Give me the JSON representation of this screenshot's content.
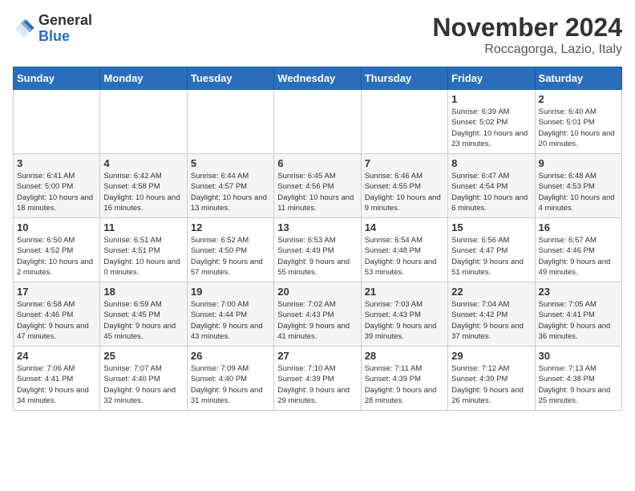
{
  "logo": {
    "general": "General",
    "blue": "Blue"
  },
  "title": "November 2024",
  "subtitle": "Roccagorga, Lazio, Italy",
  "days_header": [
    "Sunday",
    "Monday",
    "Tuesday",
    "Wednesday",
    "Thursday",
    "Friday",
    "Saturday"
  ],
  "weeks": [
    [
      {
        "day": "",
        "info": ""
      },
      {
        "day": "",
        "info": ""
      },
      {
        "day": "",
        "info": ""
      },
      {
        "day": "",
        "info": ""
      },
      {
        "day": "",
        "info": ""
      },
      {
        "day": "1",
        "info": "Sunrise: 6:39 AM\nSunset: 5:02 PM\nDaylight: 10 hours and 23 minutes."
      },
      {
        "day": "2",
        "info": "Sunrise: 6:40 AM\nSunset: 5:01 PM\nDaylight: 10 hours and 20 minutes."
      }
    ],
    [
      {
        "day": "3",
        "info": "Sunrise: 6:41 AM\nSunset: 5:00 PM\nDaylight: 10 hours and 18 minutes."
      },
      {
        "day": "4",
        "info": "Sunrise: 6:42 AM\nSunset: 4:58 PM\nDaylight: 10 hours and 16 minutes."
      },
      {
        "day": "5",
        "info": "Sunrise: 6:44 AM\nSunset: 4:57 PM\nDaylight: 10 hours and 13 minutes."
      },
      {
        "day": "6",
        "info": "Sunrise: 6:45 AM\nSunset: 4:56 PM\nDaylight: 10 hours and 11 minutes."
      },
      {
        "day": "7",
        "info": "Sunrise: 6:46 AM\nSunset: 4:55 PM\nDaylight: 10 hours and 9 minutes."
      },
      {
        "day": "8",
        "info": "Sunrise: 6:47 AM\nSunset: 4:54 PM\nDaylight: 10 hours and 6 minutes."
      },
      {
        "day": "9",
        "info": "Sunrise: 6:48 AM\nSunset: 4:53 PM\nDaylight: 10 hours and 4 minutes."
      }
    ],
    [
      {
        "day": "10",
        "info": "Sunrise: 6:50 AM\nSunset: 4:52 PM\nDaylight: 10 hours and 2 minutes."
      },
      {
        "day": "11",
        "info": "Sunrise: 6:51 AM\nSunset: 4:51 PM\nDaylight: 10 hours and 0 minutes."
      },
      {
        "day": "12",
        "info": "Sunrise: 6:52 AM\nSunset: 4:50 PM\nDaylight: 9 hours and 57 minutes."
      },
      {
        "day": "13",
        "info": "Sunrise: 6:53 AM\nSunset: 4:49 PM\nDaylight: 9 hours and 55 minutes."
      },
      {
        "day": "14",
        "info": "Sunrise: 6:54 AM\nSunset: 4:48 PM\nDaylight: 9 hours and 53 minutes."
      },
      {
        "day": "15",
        "info": "Sunrise: 6:56 AM\nSunset: 4:47 PM\nDaylight: 9 hours and 51 minutes."
      },
      {
        "day": "16",
        "info": "Sunrise: 6:57 AM\nSunset: 4:46 PM\nDaylight: 9 hours and 49 minutes."
      }
    ],
    [
      {
        "day": "17",
        "info": "Sunrise: 6:58 AM\nSunset: 4:46 PM\nDaylight: 9 hours and 47 minutes."
      },
      {
        "day": "18",
        "info": "Sunrise: 6:59 AM\nSunset: 4:45 PM\nDaylight: 9 hours and 45 minutes."
      },
      {
        "day": "19",
        "info": "Sunrise: 7:00 AM\nSunset: 4:44 PM\nDaylight: 9 hours and 43 minutes."
      },
      {
        "day": "20",
        "info": "Sunrise: 7:02 AM\nSunset: 4:43 PM\nDaylight: 9 hours and 41 minutes."
      },
      {
        "day": "21",
        "info": "Sunrise: 7:03 AM\nSunset: 4:43 PM\nDaylight: 9 hours and 39 minutes."
      },
      {
        "day": "22",
        "info": "Sunrise: 7:04 AM\nSunset: 4:42 PM\nDaylight: 9 hours and 37 minutes."
      },
      {
        "day": "23",
        "info": "Sunrise: 7:05 AM\nSunset: 4:41 PM\nDaylight: 9 hours and 36 minutes."
      }
    ],
    [
      {
        "day": "24",
        "info": "Sunrise: 7:06 AM\nSunset: 4:41 PM\nDaylight: 9 hours and 34 minutes."
      },
      {
        "day": "25",
        "info": "Sunrise: 7:07 AM\nSunset: 4:40 PM\nDaylight: 9 hours and 32 minutes."
      },
      {
        "day": "26",
        "info": "Sunrise: 7:09 AM\nSunset: 4:40 PM\nDaylight: 9 hours and 31 minutes."
      },
      {
        "day": "27",
        "info": "Sunrise: 7:10 AM\nSunset: 4:39 PM\nDaylight: 9 hours and 29 minutes."
      },
      {
        "day": "28",
        "info": "Sunrise: 7:11 AM\nSunset: 4:39 PM\nDaylight: 9 hours and 28 minutes."
      },
      {
        "day": "29",
        "info": "Sunrise: 7:12 AM\nSunset: 4:39 PM\nDaylight: 9 hours and 26 minutes."
      },
      {
        "day": "30",
        "info": "Sunrise: 7:13 AM\nSunset: 4:38 PM\nDaylight: 9 hours and 25 minutes."
      }
    ]
  ]
}
